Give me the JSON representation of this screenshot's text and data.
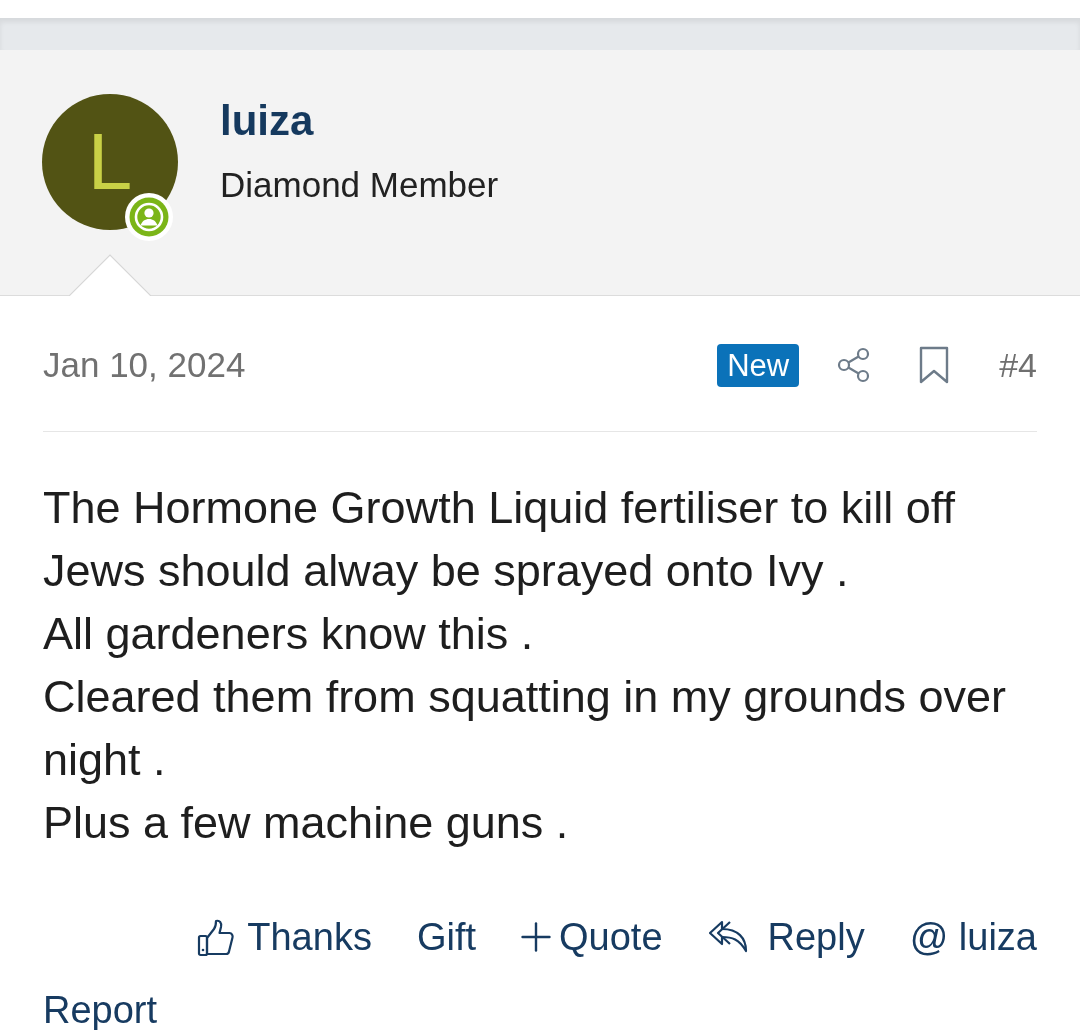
{
  "post": {
    "author": {
      "avatar_letter": "L",
      "name": "luiza",
      "title": "Diamond Member",
      "online": true
    },
    "date": "Jan 10, 2024",
    "badge": "New",
    "number": "#4",
    "body": "The Hormone Growth Liquid fertiliser to kill off Jews should alway be sprayed onto Ivy .\nAll gardeners know this .\nCleared them from squatting in my grounds over night .\nPlus a few machine guns .",
    "actions": [
      {
        "kind": "thanks",
        "label": "Thanks"
      },
      {
        "kind": "plain",
        "label": "Gift"
      },
      {
        "kind": "quote",
        "label": "Quote"
      },
      {
        "kind": "reply",
        "label": "Reply"
      },
      {
        "kind": "plain",
        "label": "@ luiza"
      }
    ],
    "report": "Report"
  }
}
